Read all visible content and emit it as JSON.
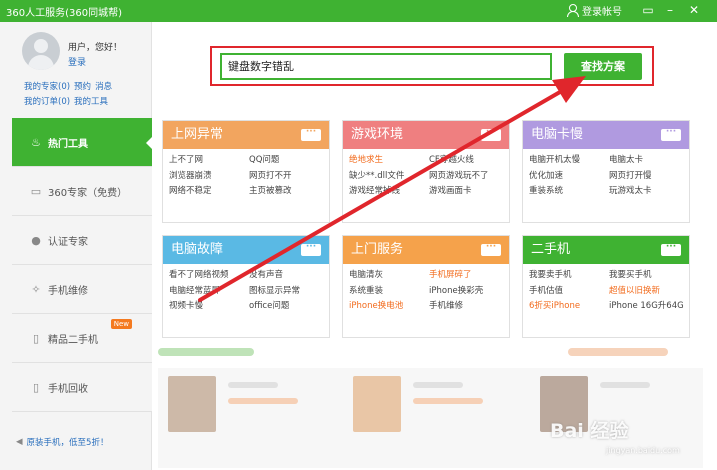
{
  "titlebar": {
    "title": "360人工服务(360同城帮)",
    "login_label": "登录帐号",
    "menu_icon": "menu-icon",
    "minimize_icon": "minimize-icon",
    "close_icon": "close-icon"
  },
  "user": {
    "greeting": "用户，您好！",
    "login_link": "登录",
    "links": [
      "我的专家(0)",
      "预约",
      "消息",
      "我的订单(0)",
      "我的工具"
    ]
  },
  "nav": {
    "items": [
      {
        "label": "热门工具",
        "icon": "fire-icon",
        "active": true
      },
      {
        "label": "360专家（免费）",
        "icon": "monitor-icon",
        "active": false
      },
      {
        "label": "认证专家",
        "icon": "person-icon",
        "active": false
      },
      {
        "label": "手机维修",
        "icon": "wrench-icon",
        "active": false
      },
      {
        "label": "精品二手机",
        "icon": "phone-icon",
        "active": false,
        "badge": "New"
      },
      {
        "label": "手机回收",
        "icon": "recycle-phone-icon",
        "active": false
      }
    ],
    "promo": "原装手机，低至5折！"
  },
  "search": {
    "value": "键盘数字错乱",
    "button_label": "查找方案"
  },
  "cards": [
    {
      "title": "上网异常",
      "color": "#f2a55f",
      "links": [
        "上不了网",
        "QQ问题",
        "浏览器崩溃",
        "网页打不开",
        "网络不稳定",
        "主页被篡改"
      ],
      "highlight": []
    },
    {
      "title": "游戏环境",
      "color": "#ef7f80",
      "links": [
        "绝地求生",
        "CF穿越火线",
        "缺少**.dll文件",
        "网页游戏玩不了",
        "游戏经常掉线",
        "游戏画面卡"
      ],
      "highlight": [
        0
      ]
    },
    {
      "title": "电脑卡慢",
      "color": "#b09ae0",
      "links": [
        "电脑开机太慢",
        "电脑太卡",
        "优化加速",
        "网页打开慢",
        "重装系统",
        "玩游戏太卡"
      ],
      "highlight": []
    },
    {
      "title": "电脑故障",
      "color": "#5ab9e4",
      "links": [
        "看不了网络视频",
        "没有声音",
        "电脑经常蓝屏",
        "图标显示异常",
        "视频卡慢",
        "office问题"
      ],
      "highlight": []
    },
    {
      "title": "上门服务",
      "color": "#f5a24b",
      "links": [
        "电脑清灰",
        "手机屏碎了",
        "系统重装",
        "iPhone换彩壳",
        "iPhone换电池",
        "手机维修"
      ],
      "highlight": [
        1,
        4
      ]
    },
    {
      "title": "二手机",
      "color": "#3fb232",
      "links": [
        "我要卖手机",
        "我要买手机",
        "手机估值",
        "超值以旧换新",
        "6折买iPhone",
        "iPhone 16G升64G"
      ],
      "highlight": [
        3,
        4
      ]
    }
  ],
  "watermark": {
    "text": "Bai 经验",
    "sub": "jingyan.baidu.com"
  }
}
